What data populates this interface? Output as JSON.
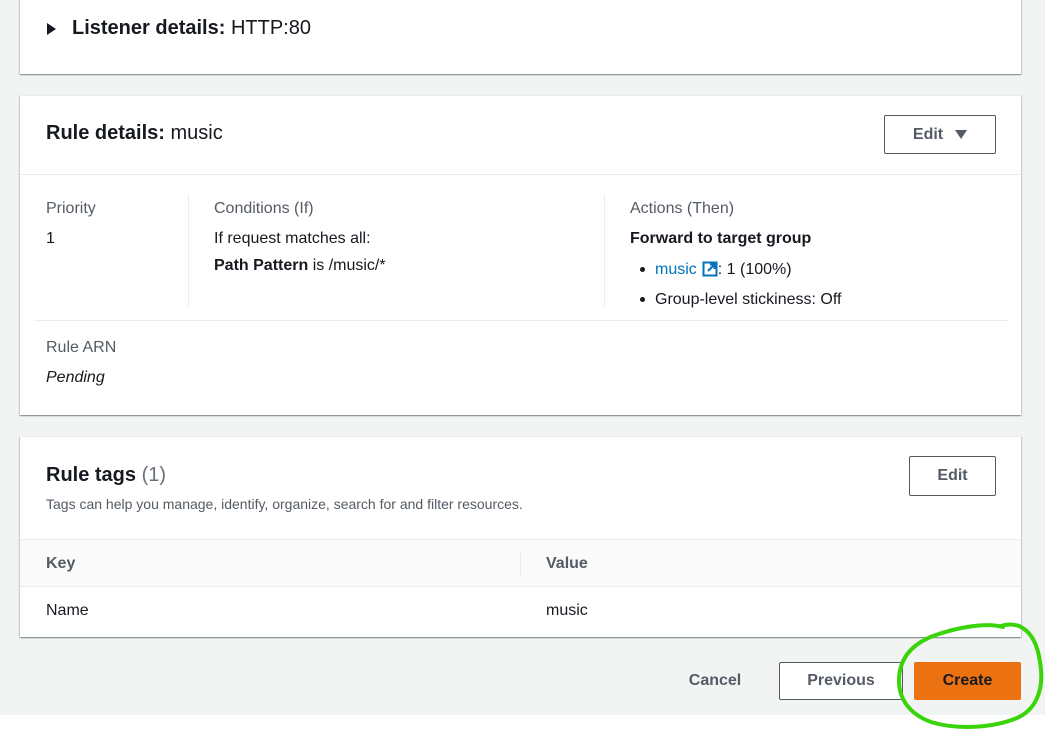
{
  "listener": {
    "label": "Listener details:",
    "value": "HTTP:80"
  },
  "rule": {
    "title_label": "Rule details:",
    "title_value": "music",
    "edit_label": "Edit",
    "priority_label": "Priority",
    "priority_value": "1",
    "conditions_label": "Conditions (If)",
    "conditions_intro": "If request matches all:",
    "condition_key": "Path Pattern",
    "condition_rest": "is /music/*",
    "actions_label": "Actions (Then)",
    "actions_title": "Forward to target group",
    "target_link": "music",
    "target_weight": ": 1 (100%)",
    "stickiness": "Group-level stickiness: Off",
    "arn_label": "Rule ARN",
    "arn_value": "Pending"
  },
  "tags": {
    "title": "Rule tags",
    "count": "(1)",
    "edit_label": "Edit",
    "description": "Tags can help you manage, identify, organize, search for and filter resources.",
    "columns": [
      "Key",
      "Value"
    ],
    "rows": [
      {
        "key": "Name",
        "value": "music"
      }
    ]
  },
  "footer": {
    "cancel": "Cancel",
    "previous": "Previous",
    "create": "Create"
  },
  "colors": {
    "primary": "#ec7211",
    "link": "#0073bb",
    "highlight": "#39d40a"
  },
  "icons": {
    "external_link": "external-link-icon",
    "expand": "caret-right-icon",
    "dropdown": "caret-down-icon"
  }
}
